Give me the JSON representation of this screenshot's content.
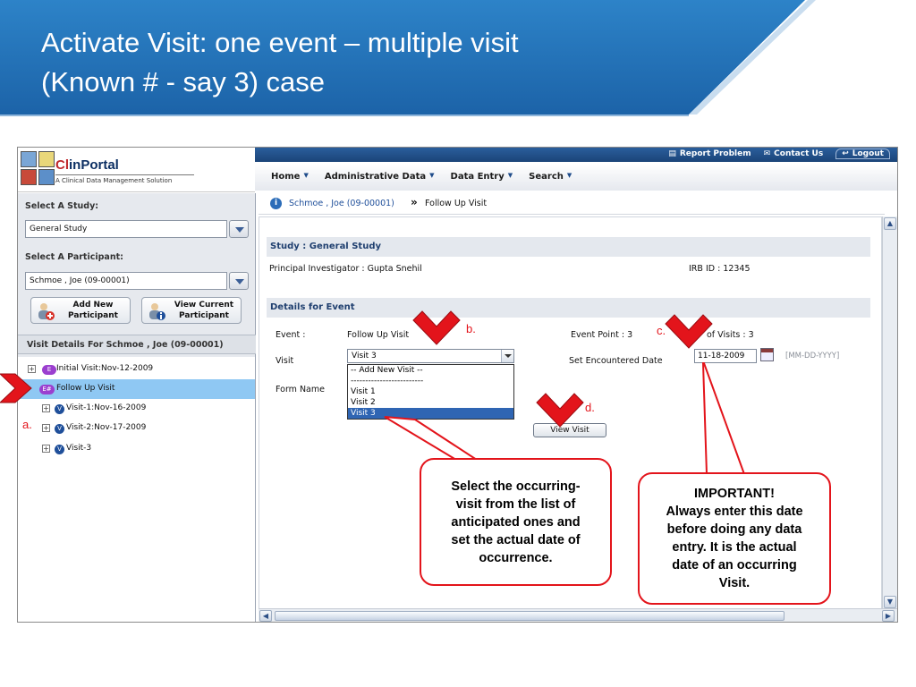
{
  "slide": {
    "title_line1": "Activate Visit: one event – multiple visit",
    "title_line2": "(Known # - say 3) case"
  },
  "app": {
    "logo": {
      "name_prefix": "Cl",
      "name_rest": "inPortal",
      "tagline": "A Clinical Data Management Solution"
    },
    "top_links": {
      "report": "Report Problem",
      "contact": "Contact Us",
      "logout": "Logout"
    },
    "menu": [
      "Home",
      "Administrative Data",
      "Data Entry",
      "Search"
    ],
    "left": {
      "study_label": "Select A Study:",
      "study_value": "General Study",
      "participant_label": "Select A Participant:",
      "participant_value": "Schmoe , Joe (09-00001)",
      "add_button": "Add New Participant",
      "view_button": "View Current Participant",
      "visit_header": "Visit Details For  Schmoe , Joe (09-00001)",
      "tree": [
        {
          "badge": "E",
          "label": "Initial Visit:Nov-12-2009"
        },
        {
          "badge": "E#",
          "label": "Follow Up Visit"
        },
        {
          "badge": "V",
          "label": "Visit-1:Nov-16-2009"
        },
        {
          "badge": "V",
          "label": "Visit-2:Nov-17-2009"
        },
        {
          "badge": "V",
          "label": "Visit-3"
        }
      ]
    },
    "breadcrumb": {
      "link": "Schmoe , Joe (09-00001)",
      "separator": "»",
      "current": "Follow Up Visit"
    },
    "study_section": {
      "header": "Study : General Study",
      "pi": "Principal Investigator : Gupta Snehil",
      "irb": "IRB ID : 12345"
    },
    "event_section": {
      "header": "Details for Event",
      "event_label": "Event :",
      "event_value": "Follow Up Visit",
      "event_point": "Event Point : 3",
      "visits_partial": "of Visits : 3",
      "visit_label": "Visit",
      "visit_selected": "Visit 3",
      "visit_options": [
        "-- Add New Visit --",
        "-------------------------",
        "Visit 1",
        "Visit 2",
        "Visit 3"
      ],
      "date_label": "Set Encountered Date",
      "date_value": "11-18-2009",
      "date_format": "[MM-DD-YYYY]",
      "form_name_label": "Form Name",
      "view_visit_button": "View Visit"
    }
  },
  "annotations": {
    "a": "a.",
    "b": "b.",
    "c": "c.",
    "d": "d.",
    "callout_select": [
      "Select the occurring-",
      "visit  from the list of",
      "anticipated ones and",
      "set the actual date of",
      "occurrence."
    ],
    "callout_important": [
      "IMPORTANT!",
      "Always enter this date",
      "before doing any data",
      "entry. It is the actual",
      "date of an occurring",
      "Visit."
    ],
    "accent_color": "#e3141b"
  }
}
